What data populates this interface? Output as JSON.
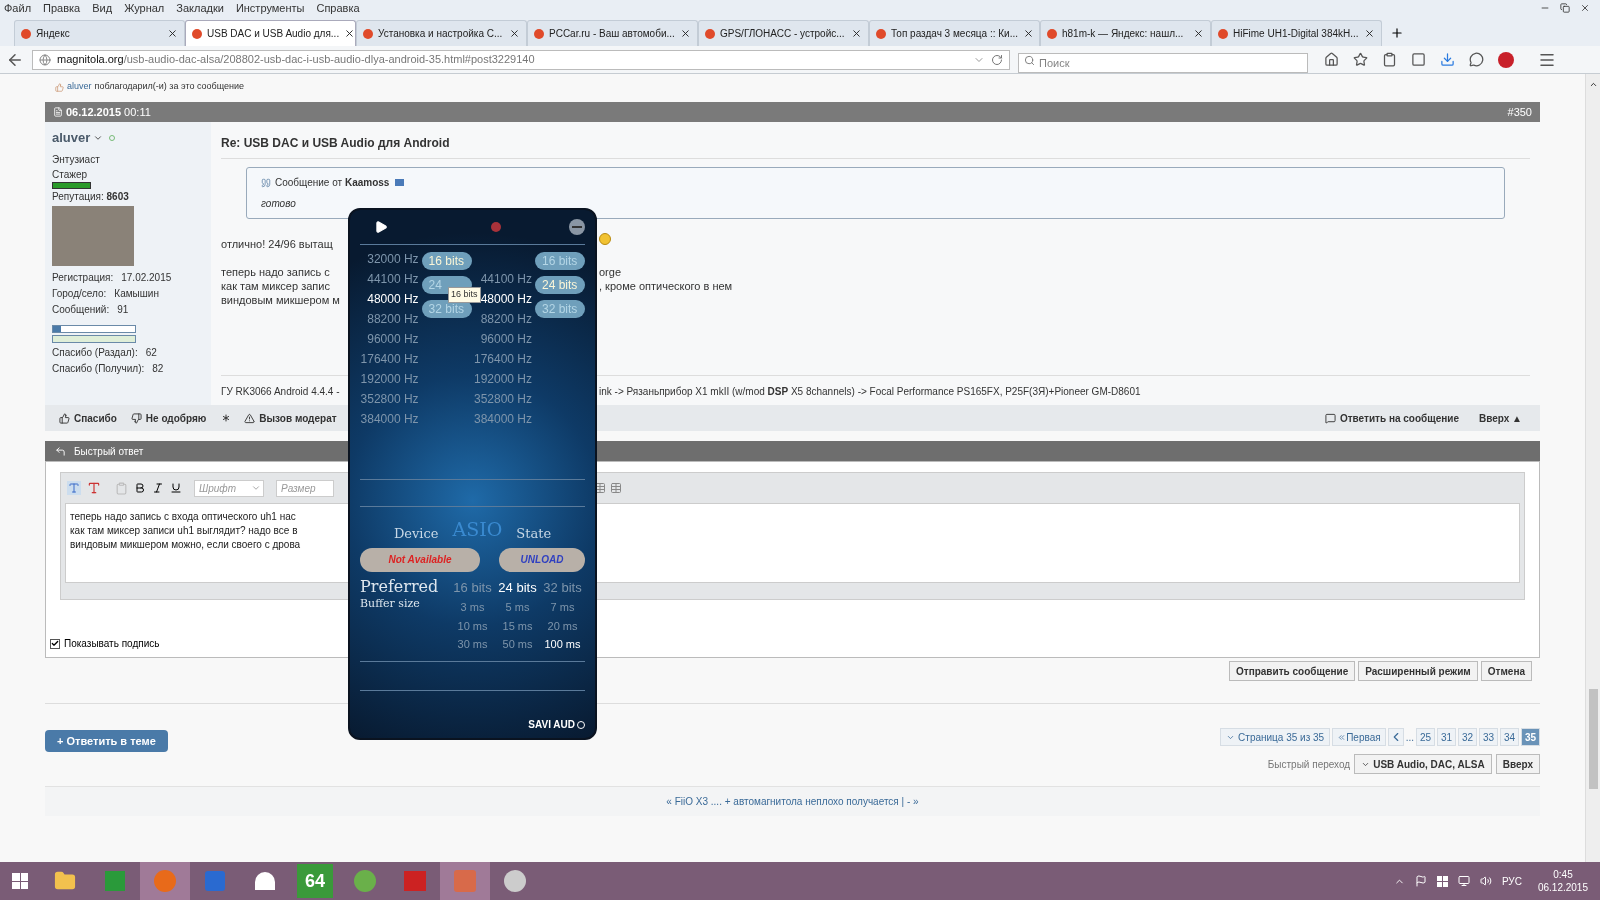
{
  "menu_bar": [
    "Файл",
    "Правка",
    "Вид",
    "Журнал",
    "Закладки",
    "Инструменты",
    "Справка"
  ],
  "tabs": [
    {
      "label": "Яндекс",
      "selected": false
    },
    {
      "label": "USB DAC и USB Audio для...",
      "selected": true
    },
    {
      "label": "Установка и настройка С...",
      "selected": false
    },
    {
      "label": "PCCar.ru - Ваш автомоби...",
      "selected": false
    },
    {
      "label": "GPS/ГЛОНАСС - устройс...",
      "selected": false
    },
    {
      "label": "Топ раздач 3 месяца :: Ки...",
      "selected": false
    },
    {
      "label": "h81m-k — Яндекс: нашл...",
      "selected": false
    },
    {
      "label": "HiFime UH1-Digital 384kH...",
      "selected": false
    }
  ],
  "address": {
    "host": "magnitola.org",
    "path": "/usb-audio-dac-alsa/208802-usb-dac-i-usb-audio-dlya-android-35.html#post3229140"
  },
  "search": {
    "placeholder": "Поиск"
  },
  "thanks_line": {
    "user": "aluver",
    "text": "поблагодарил(-и) за это сообщение"
  },
  "post": {
    "date": "**06.12.2015** 00:11",
    "number": "#350",
    "author": {
      "name": "aluver",
      "rank": "Энтузиаст",
      "status": "Стажер",
      "reputation": "Репутация: **8603**",
      "details": [
        {
          "label": "Регистрация:",
          "value": "17.02.2015"
        },
        {
          "label": "Город/село:",
          "value": "Камышин"
        },
        {
          "label": "Сообщений:",
          "value": "91"
        }
      ],
      "bars": [
        {
          "level": 0.1
        },
        {
          "level": 1
        }
      ],
      "thanks": [
        {
          "label": "Спасибо (Раздал):",
          "value": "62"
        },
        {
          "label": "Спасибо (Получил):",
          "value": "82"
        }
      ]
    },
    "title": "Re: USB DAC и USB Audio для Android",
    "quote": {
      "header": "Сообщение от **Kaamoss**",
      "text": "готово"
    },
    "paragraphs": [
      [
        {
          "left": "отлично! 24/96 вытащ"
        }
      ],
      [
        {
          "left": "теперь надо запись с",
          "right": "orge"
        },
        {
          "left": "как там миксер запис",
          "right": ", кроме оптического в нем"
        },
        {
          "left": "виндовым микшером м"
        }
      ]
    ],
    "signature": {
      "left": "ГУ RK3066 Android 4.4.4 -",
      "right": "ink -> Рязаньприбор X1 mkII (w/mod **DSP** X5 8channels) -> Focal Performance PS165FX, P25F(3Я)+Pioneer GM-D8601"
    },
    "actions_left": [
      "Спасибо",
      "Не одобряю",
      "Вызов модерат"
    ],
    "actions_right": [
      "Ответить на сообщение",
      "Вверх ▲"
    ]
  },
  "quick_reply": {
    "title": "Быстрый ответ",
    "font_placeholder": "Шрифт",
    "size_placeholder": "Размер",
    "text_lines": [
      "теперь надо запись с входа оптического uh1 нас",
      "как там миксер записи uh1 выглядит? надо все в",
      "виндовым микшером можно, если своего с дрова"
    ],
    "show_signature": {
      "label": "Показывать подпись",
      "checked": true
    },
    "buttons": [
      "Отправить сообщение",
      "Расширенный режим",
      "Отмена"
    ]
  },
  "reply_thread_button": "+ Ответить в теме",
  "pagination": {
    "summary": "Страница 35 из 35",
    "first": "Первая",
    "ellipsis": "...",
    "pages": [
      {
        "label": "25",
        "selected": false
      },
      {
        "label": "31",
        "selected": false
      },
      {
        "label": "32",
        "selected": false
      },
      {
        "label": "33",
        "selected": false
      },
      {
        "label": "34",
        "selected": false
      },
      {
        "label": "35",
        "selected": true
      }
    ]
  },
  "quick_jump": {
    "label": "Быстрый переход",
    "forum": "USB Audio, DAC, ALSA",
    "top": "Вверх"
  },
  "thread_nav": "« FiiO X3 .... + автомагнитола неплохо получается | - »",
  "audio_panel": {
    "tooltip": "16 bits",
    "left_rates": [
      {
        "label": "32000 Hz",
        "selected": false
      },
      {
        "label": "44100 Hz",
        "selected": false
      },
      {
        "label": "48000 Hz",
        "selected": true
      },
      {
        "label": "88200 Hz",
        "selected": false
      },
      {
        "label": "96000 Hz",
        "selected": false
      },
      {
        "label": "176400 Hz",
        "selected": false
      },
      {
        "label": "192000 Hz",
        "selected": false
      },
      {
        "label": "352800 Hz",
        "selected": false
      },
      {
        "label": "384000 Hz",
        "selected": false
      }
    ],
    "left_bits": [
      {
        "label": "16 bits",
        "selected": true
      },
      {
        "label": "24",
        "selected": false
      },
      {
        "label": "32 bits",
        "selected": false
      }
    ],
    "right_rates": [
      {
        "label": "44100 Hz",
        "selected": false
      },
      {
        "label": "48000 Hz",
        "selected": true
      },
      {
        "label": "88200 Hz",
        "selected": false
      },
      {
        "label": "96000 Hz",
        "selected": false
      },
      {
        "label": "176400 Hz",
        "selected": false
      },
      {
        "label": "192000 Hz",
        "selected": false
      },
      {
        "label": "352800 Hz",
        "selected": false
      },
      {
        "label": "384000 Hz",
        "selected": false
      }
    ],
    "right_bits": [
      {
        "label": "16 bits",
        "selected": false
      },
      {
        "label": "24 bits",
        "selected": true
      },
      {
        "label": "32 bits",
        "selected": false
      }
    ],
    "device_label": "Device",
    "driver": "ASIO",
    "state_label": "State",
    "device_value": "Not Available",
    "state_value": "UNLOAD",
    "preferred_label": "Preferred",
    "buffer_label": "Buffer size",
    "preferred_bits": [
      {
        "label": "16 bits",
        "selected": false
      },
      {
        "label": "24 bits",
        "selected": true
      },
      {
        "label": "32 bits",
        "selected": false
      }
    ],
    "buffer_sizes": [
      {
        "label": "3 ms",
        "selected": false
      },
      {
        "label": "5 ms",
        "selected": false
      },
      {
        "label": "7 ms",
        "selected": false
      },
      {
        "label": "10 ms",
        "selected": false
      },
      {
        "label": "15 ms",
        "selected": false
      },
      {
        "label": "20 ms",
        "selected": false
      },
      {
        "label": "30 ms",
        "selected": false
      },
      {
        "label": "50 ms",
        "selected": false
      },
      {
        "label": "100 ms",
        "selected": true
      }
    ],
    "logo": "SAVI AUD"
  },
  "taskbar": {
    "app_badge": "64",
    "language": "РУС",
    "time": "0:45",
    "date": "06.12.2015"
  }
}
